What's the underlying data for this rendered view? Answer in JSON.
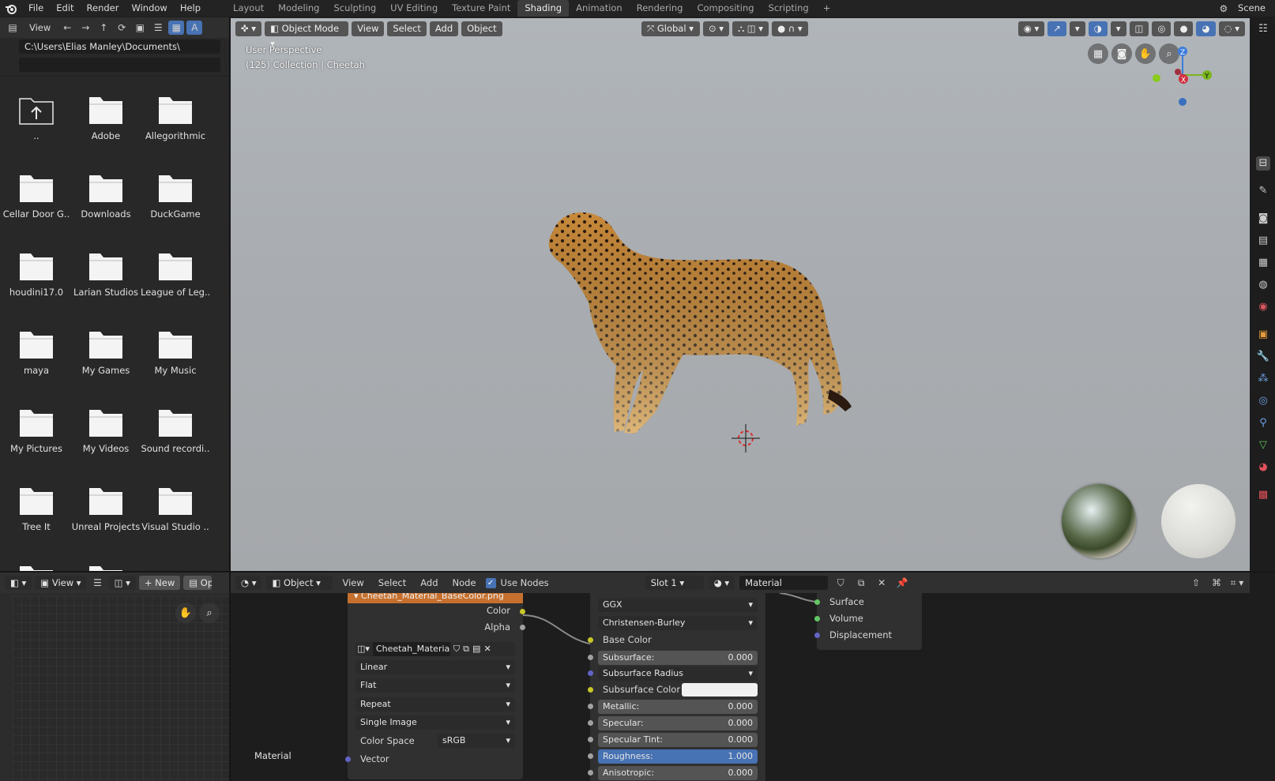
{
  "menu": {
    "items": [
      "File",
      "Edit",
      "Render",
      "Window",
      "Help"
    ]
  },
  "workspaces": {
    "tabs": [
      "Layout",
      "Modeling",
      "Sculpting",
      "UV Editing",
      "Texture Paint",
      "Shading",
      "Animation",
      "Rendering",
      "Compositing",
      "Scripting"
    ],
    "active": "Shading"
  },
  "scene": {
    "label": "Scene"
  },
  "file_browser": {
    "header_view": "View",
    "path": "C:\\Users\\Elias Manley\\Documents\\",
    "filter": "",
    "items": [
      {
        "label": "..",
        "icon": "parent-folder-icon"
      },
      {
        "label": "Adobe"
      },
      {
        "label": "Allegorithmic"
      },
      {
        "label": "Cellar Door G.."
      },
      {
        "label": "Downloads"
      },
      {
        "label": "DuckGame"
      },
      {
        "label": "houdini17.0"
      },
      {
        "label": "Larian Studios"
      },
      {
        "label": "League of Leg.."
      },
      {
        "label": "maya"
      },
      {
        "label": "My Games"
      },
      {
        "label": "My Music"
      },
      {
        "label": "My Pictures"
      },
      {
        "label": "My Videos"
      },
      {
        "label": "Sound recordi.."
      },
      {
        "label": "Tree It"
      },
      {
        "label": "Unreal Projects"
      },
      {
        "label": "Visual Studio .."
      }
    ]
  },
  "viewport": {
    "mode": "Object Mode",
    "menus": [
      "View",
      "Select",
      "Add",
      "Object"
    ],
    "transform_orientation": "Global",
    "overlay_title": "User Perspective",
    "overlay_collection": "(125) Collection | Cheetah",
    "gizmo": {
      "x": "X",
      "y": "Y",
      "z": "Z"
    }
  },
  "image_editor": {
    "view": "View",
    "new": "New",
    "open": "Open"
  },
  "node_editor": {
    "object_type": "Object",
    "menus": [
      "View",
      "Select",
      "Add",
      "Node"
    ],
    "use_nodes_label": "Use Nodes",
    "use_nodes": true,
    "slot": "Slot 1",
    "material": "Material",
    "canvas_label": "Material",
    "image_node": {
      "title": "Cheetah_Material_BaseColor.png",
      "out_color": "Color",
      "out_alpha": "Alpha",
      "image_name": "Cheetah_Materia..",
      "interpolation": "Linear",
      "projection": "Flat",
      "extension": "Repeat",
      "source": "Single Image",
      "color_space_label": "Color Space",
      "color_space": "sRGB",
      "in_vector": "Vector"
    },
    "bsdf_node": {
      "distribution": "GGX",
      "subsurface_method": "Christensen-Burley",
      "base_color": "Base Color",
      "subsurface_label": "Subsurface:",
      "subsurface": "0.000",
      "subsurface_radius": "Subsurface Radius",
      "subsurface_color": "Subsurface Color",
      "metallic_label": "Metallic:",
      "metallic": "0.000",
      "specular_label": "Specular:",
      "specular": "0.000",
      "specular_tint_label": "Specular Tint:",
      "specular_tint": "0.000",
      "roughness_label": "Roughness:",
      "roughness": "1.000",
      "anisotropic_label": "Anisotropic:",
      "anisotropic": "0.000"
    },
    "output_node": {
      "surface": "Surface",
      "volume": "Volume",
      "displacement": "Displacement"
    }
  },
  "colors": {
    "accent_blue": "#4772b3",
    "node_header_image": "#c5702e",
    "socket_yellow": "#c7c729",
    "socket_grey": "#a1a1a1",
    "socket_purple": "#6363c7",
    "socket_green": "#63c763"
  }
}
